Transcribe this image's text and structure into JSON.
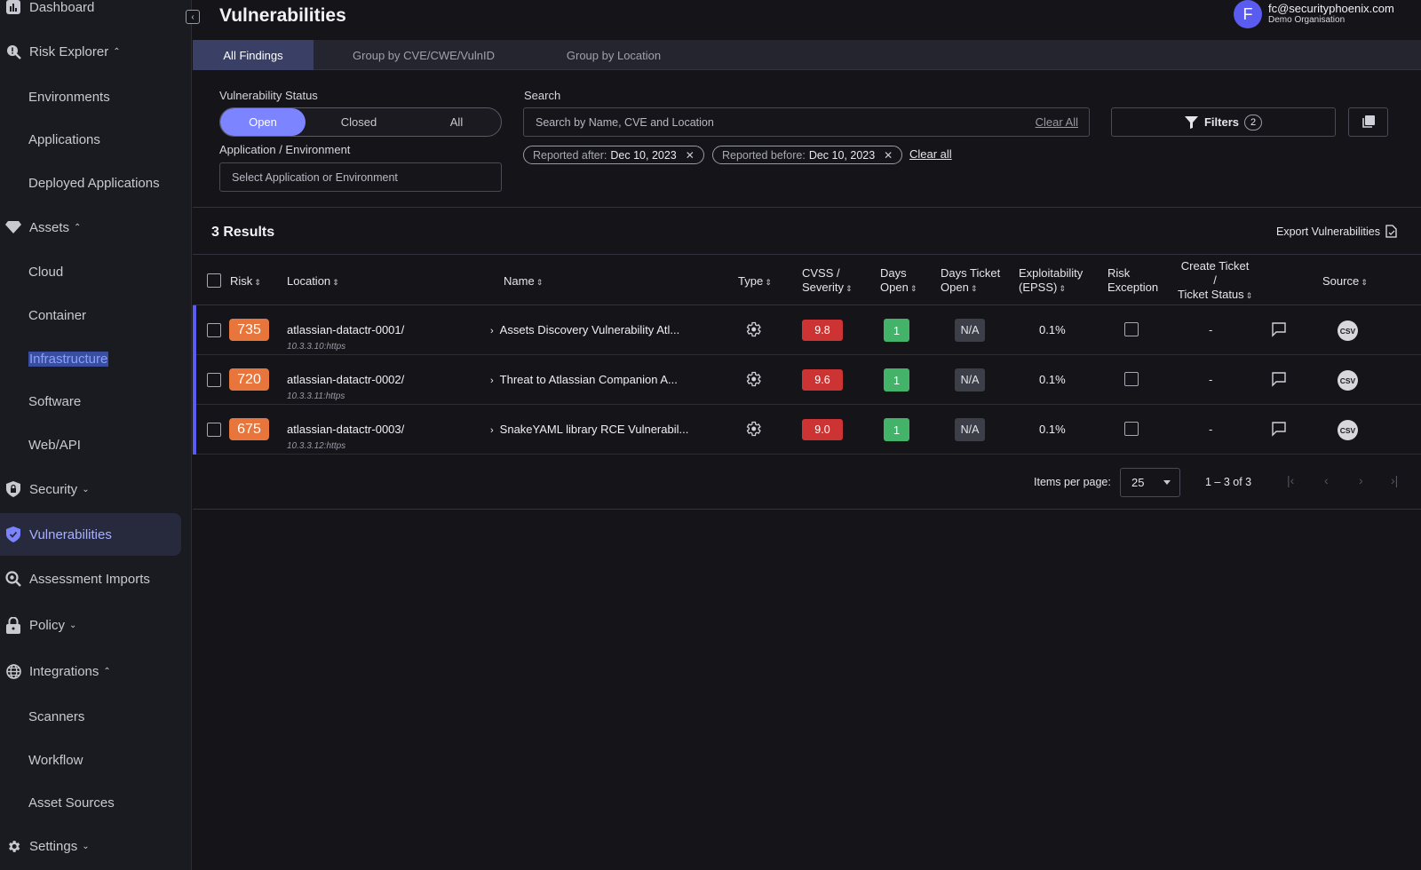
{
  "sidebar": {
    "items": [
      {
        "label": "Dashboard",
        "icon": "bar-chart-icon",
        "chevron": ""
      },
      {
        "label": "Risk Explorer",
        "icon": "risk-explorer-icon",
        "chevron": "^"
      },
      {
        "label": "Environments"
      },
      {
        "label": "Applications"
      },
      {
        "label": "Deployed Applications"
      },
      {
        "label": "Assets",
        "icon": "diamond-icon",
        "chevron": "^"
      },
      {
        "label": "Cloud"
      },
      {
        "label": "Container"
      },
      {
        "label": "Infrastructure"
      },
      {
        "label": "Software"
      },
      {
        "label": "Web/API"
      },
      {
        "label": "Security",
        "icon": "shield-lock-icon",
        "chevron": "v"
      },
      {
        "label": "Vulnerabilities",
        "icon": "shield-check-icon"
      },
      {
        "label": "Assessment Imports",
        "icon": "search-icon"
      },
      {
        "label": "Policy",
        "icon": "lock-icon",
        "chevron": "v"
      },
      {
        "label": "Integrations",
        "icon": "globe-icon",
        "chevron": "^"
      },
      {
        "label": "Scanners"
      },
      {
        "label": "Workflow"
      },
      {
        "label": "Asset Sources"
      },
      {
        "label": "Settings",
        "icon": "gear-icon",
        "chevron": "v"
      }
    ]
  },
  "header": {
    "title": "Vulnerabilities",
    "avatar_letter": "F",
    "user_email": "fc@securityphoenix.com",
    "user_org": "Demo Organisation"
  },
  "tabs": [
    "All Findings",
    "Group by CVE/CWE/VulnID",
    "Group by Location"
  ],
  "filters": {
    "status_label": "Vulnerability Status",
    "status_options": [
      "Open",
      "Closed",
      "All"
    ],
    "status_selected": "Open",
    "app_env_label": "Application / Environment",
    "app_env_placeholder": "Select Application or Environment",
    "search_label": "Search",
    "search_placeholder": "Search by Name, CVE and Location",
    "search_clear": "Clear All",
    "chips": [
      {
        "label": "Reported after:",
        "value": "Dec 10, 2023"
      },
      {
        "label": "Reported before:",
        "value": "Dec 10, 2023"
      }
    ],
    "chips_clear": "Clear all",
    "filters_button": "Filters",
    "filters_count": "2"
  },
  "results": {
    "title": "3 Results",
    "export_label": "Export Vulnerabilities"
  },
  "table": {
    "headers": {
      "risk": "Risk",
      "location": "Location",
      "name": "Name",
      "type": "Type",
      "cvss_1": "CVSS /",
      "cvss_2": "Severity",
      "days_1": "Days",
      "days_2": "Open",
      "ticket_1": "Days Ticket",
      "ticket_2": "Open",
      "epss_1": "Exploitability",
      "epss_2": "(EPSS)",
      "exception_1": "Risk",
      "exception_2": "Exception",
      "create_1": "Create Ticket",
      "create_2": "/",
      "create_3": "Ticket Status",
      "source": "Source"
    },
    "rows": [
      {
        "risk": "735",
        "location": "atlassian-datactr-0001/",
        "location_sub": "10.3.3.10:https",
        "name": "Assets Discovery Vulnerability Atl...",
        "cvss": "9.8",
        "days_open": "1",
        "days_ticket": "N/A",
        "epss": "0.1%",
        "ticket_status": "-",
        "source": "CSV"
      },
      {
        "risk": "720",
        "location": "atlassian-datactr-0002/",
        "location_sub": "10.3.3.11:https",
        "name": "Threat to Atlassian Companion A...",
        "cvss": "9.6",
        "days_open": "1",
        "days_ticket": "N/A",
        "epss": "0.1%",
        "ticket_status": "-",
        "source": "CSV"
      },
      {
        "risk": "675",
        "location": "atlassian-datactr-0003/",
        "location_sub": "10.3.3.12:https",
        "name": "SnakeYAML library RCE Vulnerabil...",
        "cvss": "9.0",
        "days_open": "1",
        "days_ticket": "N/A",
        "epss": "0.1%",
        "ticket_status": "-",
        "source": "CSV"
      }
    ]
  },
  "paginator": {
    "items_per_page_label": "Items per page:",
    "page_size": "25",
    "range": "1 – 3 of 3"
  },
  "colors": {
    "accent": "#7c84ff",
    "risk_badge": "#e8753b",
    "cvss_critical": "#cc3333",
    "days_green": "#43b36a"
  }
}
